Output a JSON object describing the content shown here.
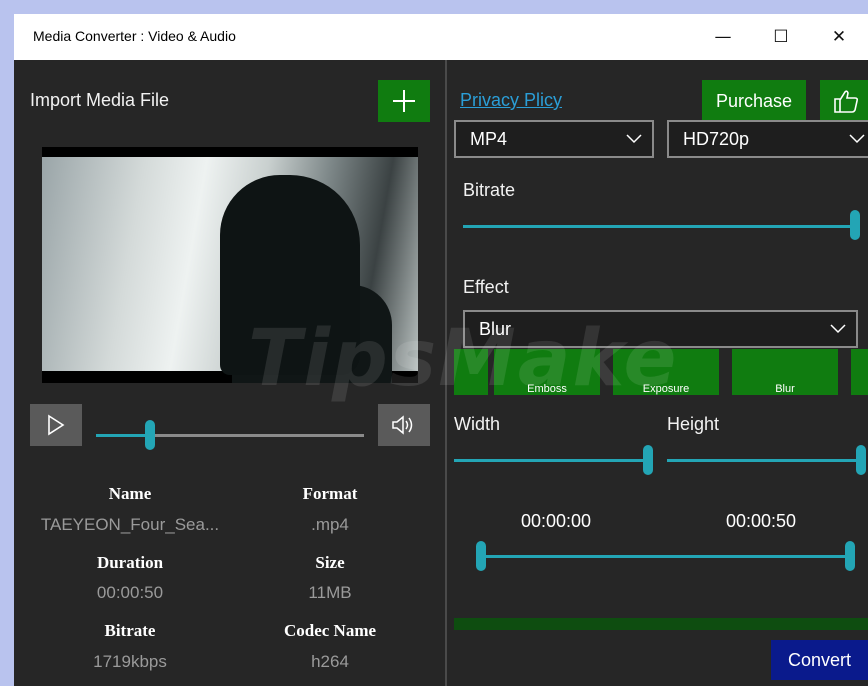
{
  "window": {
    "title": "Media Converter : Video & Audio",
    "minimize_glyph": "—",
    "maximize_glyph": "☐",
    "close_glyph": "✕"
  },
  "left": {
    "import_label": "Import Media File",
    "add_icon": "plus-icon",
    "player": {
      "play_icon": "play-icon",
      "volume_icon": "volume-icon",
      "seek_position_percent": 20
    },
    "info": {
      "name_label": "Name",
      "name_value": "TAEYEON_Four_Sea...",
      "format_label": "Format",
      "format_value": ".mp4",
      "duration_label": "Duration",
      "duration_value": "00:00:50",
      "size_label": "Size",
      "size_value": "11MB",
      "bitrate_label": "Bitrate",
      "bitrate_value": "1719kbps",
      "codec_label": "Codec Name",
      "codec_value": "h264"
    }
  },
  "right": {
    "privacy_link": "Privacy Plicy",
    "purchase_label": "Purchase",
    "like_icon": "thumbs-up-icon",
    "format_select": "MP4",
    "quality_select": "HD720p",
    "bitrate_label": "Bitrate",
    "bitrate_percent": 100,
    "effect_label": "Effect",
    "effect_select": "Blur",
    "effect_tiles": [
      "Emboss",
      "Exposure",
      "Blur"
    ],
    "width_label": "Width",
    "height_label": "Height",
    "width_percent": 100,
    "height_percent": 100,
    "trim_start": "00:00:00",
    "trim_end": "00:00:50",
    "convert_label": "Convert"
  },
  "watermark": "TipsMake",
  "colors": {
    "accent_green": "#107c10",
    "slider_teal": "#23a5b5",
    "convert_blue": "#0a1a8c",
    "link_blue": "#2b9ed7"
  }
}
